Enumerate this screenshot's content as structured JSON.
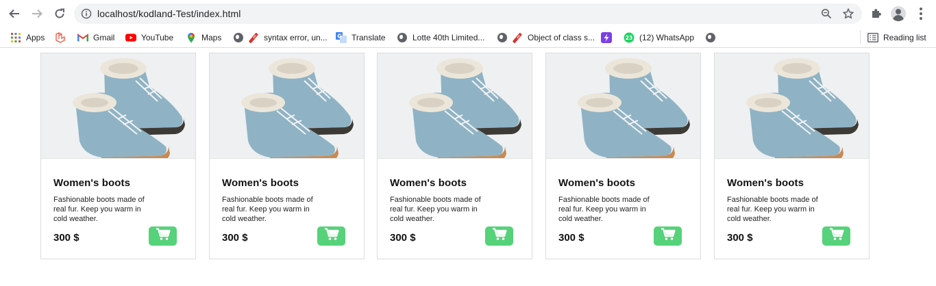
{
  "browser": {
    "url": "localhost/kodland-Test/index.html",
    "icons": {
      "back": "back-arrow-icon",
      "forward": "forward-arrow-icon",
      "reload": "reload-icon",
      "info": "info-icon",
      "zoom": "zoom-icon",
      "bookmark_star": "star-icon",
      "extensions": "puzzle-icon",
      "profile": "profile-icon",
      "menu": "kebab-menu-icon"
    }
  },
  "bookmarks": {
    "items": [
      {
        "label": "Apps",
        "icon": "apps-grid-icon"
      },
      {
        "label": "",
        "icon": "laravel-icon"
      },
      {
        "label": "Gmail",
        "icon": "gmail-icon"
      },
      {
        "label": "YouTube",
        "icon": "youtube-icon"
      },
      {
        "label": "Maps",
        "icon": "maps-icon"
      },
      {
        "label": "",
        "icon": "globe-icon"
      },
      {
        "label": "syntax error, un...",
        "icon": "ruby-icon"
      },
      {
        "label": "Translate",
        "icon": "translate-icon"
      },
      {
        "label": "Lotte 40th Limited...",
        "icon": "globe-icon"
      },
      {
        "label": "",
        "icon": "globe-icon"
      },
      {
        "label": "Object of class s...",
        "icon": "ruby-icon"
      },
      {
        "label": "",
        "icon": "lightning-icon"
      },
      {
        "label": "(12) WhatsApp",
        "icon": "whatsapp-icon",
        "badge": "23"
      },
      {
        "label": "",
        "icon": "globe-icon"
      }
    ],
    "reading_list": "Reading list"
  },
  "colors": {
    "cart_button": "#56d27a",
    "boot": "#8fb3c4",
    "fur": "#ece6da",
    "sole": "#c98a52"
  },
  "products": [
    {
      "title": "Women's boots",
      "description": "Fashionable boots made of real fur. Keep you warm in cold weather.",
      "price": "300 $",
      "icon": "shopping-cart-icon"
    },
    {
      "title": "Women's boots",
      "description": "Fashionable boots made of real fur. Keep you warm in cold weather.",
      "price": "300 $",
      "icon": "shopping-cart-icon"
    },
    {
      "title": "Women's boots",
      "description": "Fashionable boots made of real fur. Keep you warm in cold weather.",
      "price": "300 $",
      "icon": "shopping-cart-icon"
    },
    {
      "title": "Women's boots",
      "description": "Fashionable boots made of real fur. Keep you warm in cold weather.",
      "price": "300 $",
      "icon": "shopping-cart-icon"
    },
    {
      "title": "Women's boots",
      "description": "Fashionable boots made of real fur. Keep you warm in cold weather.",
      "price": "300 $",
      "icon": "shopping-cart-icon"
    }
  ]
}
